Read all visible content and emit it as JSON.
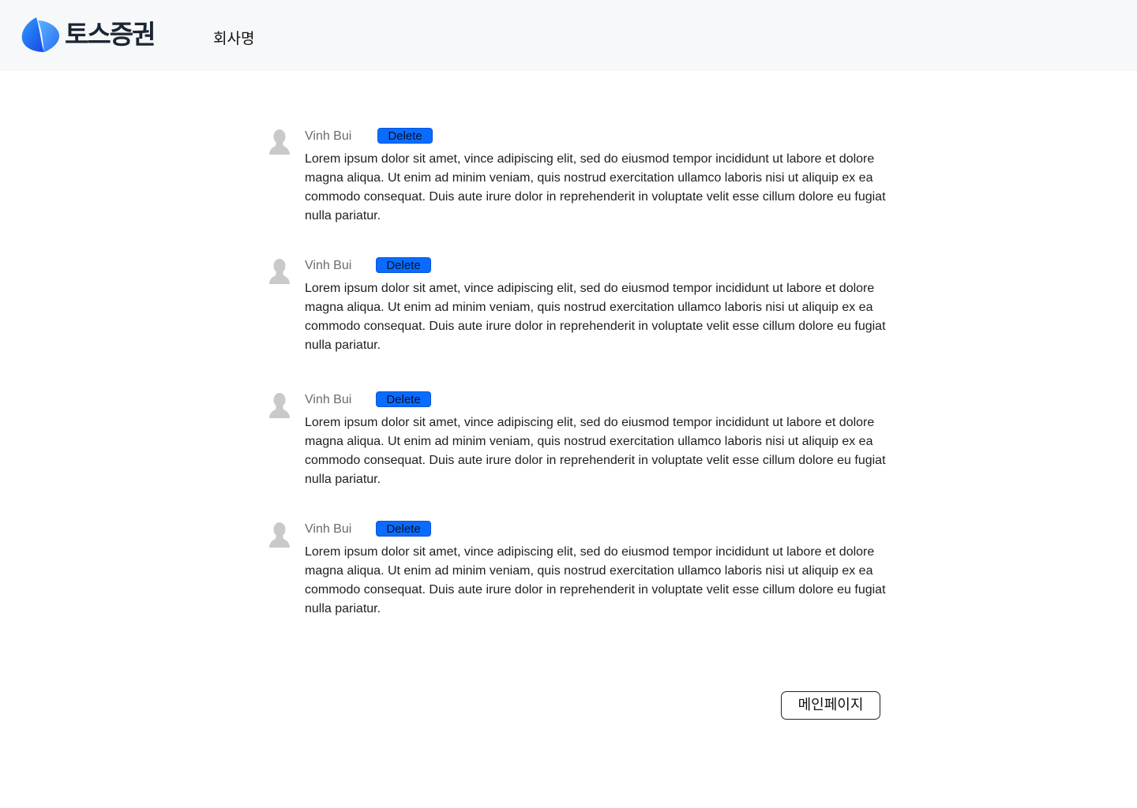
{
  "header": {
    "logo_text": "토스증권",
    "logo_icon": "toss-logo-icon",
    "company_name": "회사명"
  },
  "comments": [
    {
      "author": "Vinh Bui",
      "delete_label": "Delete",
      "text": "Lorem ipsum dolor sit amet, vince adipiscing elit, sed do eiusmod tempor incididunt ut labore et dolore magna aliqua. Ut enim ad minim veniam, quis nostrud exercitation ullamco laboris nisi ut aliquip ex ea commodo consequat. Duis aute irure dolor in reprehenderit in voluptate velit esse cillum dolore eu fugiat nulla pariatur."
    },
    {
      "author": "Vinh Bui",
      "delete_label": "Delete",
      "text": "Lorem ipsum dolor sit amet, vince adipiscing elit, sed do eiusmod tempor incididunt ut labore et dolore magna aliqua. Ut enim ad minim veniam, quis nostrud exercitation ullamco laboris nisi ut aliquip ex ea commodo consequat. Duis aute irure dolor in reprehenderit in voluptate velit esse cillum dolore eu fugiat nulla pariatur."
    },
    {
      "author": "Vinh Bui",
      "delete_label": "Delete",
      "text": "Lorem ipsum dolor sit amet, vince adipiscing elit, sed do eiusmod tempor incididunt ut labore et dolore magna aliqua. Ut enim ad minim veniam, quis nostrud exercitation ullamco laboris nisi ut aliquip ex ea commodo consequat. Duis aute irure dolor in reprehenderit in voluptate velit esse cillum dolore eu fugiat nulla pariatur."
    },
    {
      "author": "Vinh Bui",
      "delete_label": "Delete",
      "text": "Lorem ipsum dolor sit amet, vince adipiscing elit, sed do eiusmod tempor incididunt ut labore et dolore magna aliqua. Ut enim ad minim veniam, quis nostrud exercitation ullamco laboris nisi ut aliquip ex ea commodo consequat. Duis aute irure dolor in reprehenderit in voluptate velit esse cillum dolore eu fugiat nulla pariatur."
    }
  ],
  "footer": {
    "main_page_label": "메인페이지"
  },
  "colors": {
    "header_bg": "#f7f8fa",
    "delete_button": "#0a6cff",
    "logo_blue": "#1f6fff",
    "author_text": "#6b6b6b"
  }
}
